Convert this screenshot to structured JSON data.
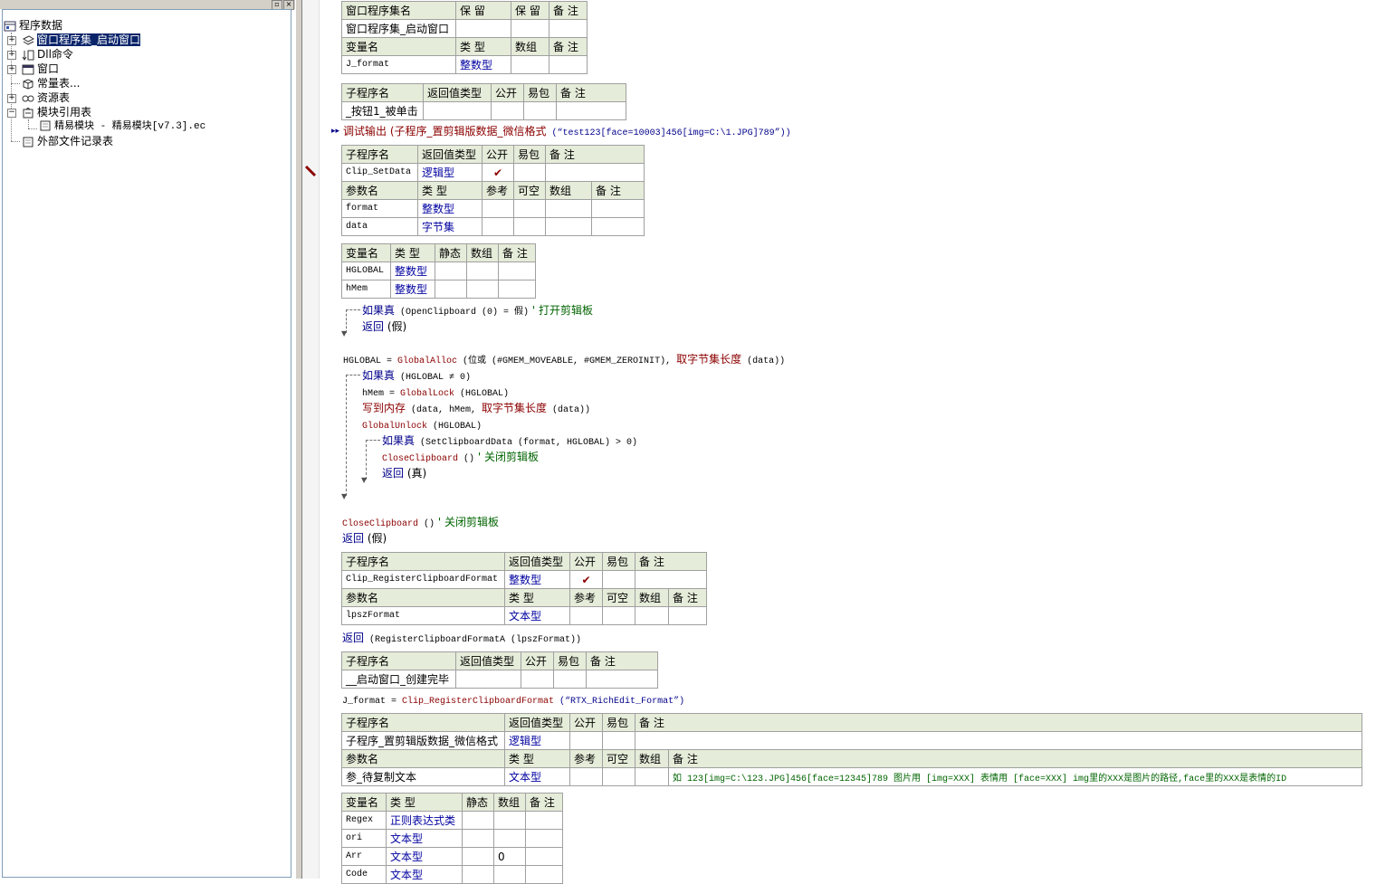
{
  "tree": {
    "root": "程序数据",
    "items": [
      {
        "label": "窗口程序集_启动窗口",
        "selected": true
      },
      {
        "label": "Dll命令"
      },
      {
        "label": "窗口"
      },
      {
        "label": "常量表..."
      },
      {
        "label": "资源表"
      },
      {
        "label": "模块引用表"
      },
      {
        "label": "精易模块 - 精易模块[v7.3].ec"
      },
      {
        "label": "外部文件记录表"
      }
    ]
  },
  "assembly_table": {
    "h1": [
      "窗口程序集名",
      "保 留",
      "保 留",
      "备 注"
    ],
    "r1": [
      "窗口程序集_启动窗口",
      "",
      "",
      ""
    ],
    "h2": [
      "变量名",
      "类 型",
      "数组",
      "备 注"
    ],
    "r2": [
      "J_format",
      "整数型",
      "",
      ""
    ]
  },
  "sub1": {
    "h": [
      "子程序名",
      "返回值类型",
      "公开",
      "易包",
      "备 注"
    ],
    "r": [
      "_按钮1_被单击",
      "",
      "",
      "",
      ""
    ]
  },
  "code1": {
    "kw": "调试输出",
    "open": "(",
    "fn": "子程序_置剪辑版数据_微信格式",
    "arg": " (“test123[face=10003]456[img=C:\\1.JPG]789”))"
  },
  "sub2": {
    "h": [
      "子程序名",
      "返回值类型",
      "公开",
      "易包",
      "备 注"
    ],
    "r": [
      "Clip_SetData",
      "逻辑型",
      "✔",
      "",
      ""
    ],
    "ph": [
      "参数名",
      "类 型",
      "参考",
      "可空",
      "数组",
      "备 注"
    ],
    "p": [
      [
        "format",
        "整数型",
        "",
        "",
        "",
        ""
      ],
      [
        "data",
        "字节集",
        "",
        "",
        "",
        ""
      ]
    ],
    "vh": [
      "变量名",
      "类 型",
      "静态",
      "数组",
      "备 注"
    ],
    "v": [
      [
        "HGLOBAL",
        "整数型",
        "",
        "",
        ""
      ],
      [
        "hMem",
        "整数型",
        "",
        "",
        ""
      ]
    ]
  },
  "code2": [
    {
      "a": "如果真",
      "b": " (OpenClipboard (0) = 假)",
      "c": " ' 打开剪辑板"
    },
    {
      "a": "返回",
      "b": " (假)",
      "c": ""
    },
    {
      "a": "HGLOBAL = ",
      "f": "GlobalAlloc",
      "b": " (位或 (#GMEM_MOVEABLE, #GMEM_ZEROINIT), ",
      "f2": "取字节集长度",
      "b2": " (data))"
    },
    {
      "a": "如果真",
      "b": " (HGLOBAL ≠ 0)",
      "c": ""
    },
    {
      "a": "hMem = ",
      "f": "GlobalLock",
      "b": " (HGLOBAL)"
    },
    {
      "a": "写到内存",
      "b": " (data, hMem, ",
      "f2": "取字节集长度",
      "b2": " (data))"
    },
    {
      "a": "GlobalUnlock",
      "b": " (HGLOBAL)"
    },
    {
      "a": "如果真",
      "b": " (SetClipboardData (format, HGLOBAL) > 0)"
    },
    {
      "a": "CloseClipboard",
      "b": " ()",
      "c": " ' 关闭剪辑板"
    },
    {
      "a": "返回",
      "b": " (真)"
    },
    {
      "a": "CloseClipboard",
      "b": " ()",
      "c": " ' 关闭剪辑板"
    },
    {
      "a": "返回",
      "b": " (假)"
    }
  ],
  "sub3": {
    "h": [
      "子程序名",
      "返回值类型",
      "公开",
      "易包",
      "备 注"
    ],
    "r": [
      "Clip_RegisterClipboardFormat",
      "整数型",
      "✔",
      "",
      ""
    ],
    "ph": [
      "参数名",
      "类 型",
      "参考",
      "可空",
      "数组",
      "备 注"
    ],
    "p": [
      [
        "lpszFormat",
        "文本型",
        "",
        "",
        "",
        ""
      ]
    ]
  },
  "code3": {
    "a": "返回",
    "b": " (RegisterClipboardFormatA (lpszFormat))"
  },
  "sub4": {
    "h": [
      "子程序名",
      "返回值类型",
      "公开",
      "易包",
      "备 注"
    ],
    "r": [
      "__启动窗口_创建完毕",
      "",
      "",
      "",
      ""
    ]
  },
  "code4": {
    "a": "J_format = ",
    "f": "Clip_RegisterClipboardFormat",
    "b": " (“RTX_RichEdit_Format”)"
  },
  "sub5": {
    "h": [
      "子程序名",
      "返回值类型",
      "公开",
      "易包",
      "备 注"
    ],
    "r": [
      "子程序_置剪辑版数据_微信格式",
      "逻辑型",
      "",
      "",
      ""
    ],
    "ph": [
      "参数名",
      "类 型",
      "参考",
      "可空",
      "数组",
      "备 注"
    ],
    "p": [
      [
        "参_待复制文本",
        "文本型",
        "",
        "",
        "",
        "如 123[img=C:\\123.JPG]456[face=12345]789    图片用 [img=XXX]  表情用 [face=XXX]   img里的XXX是图片的路径,face里的XXX是表情的ID"
      ]
    ],
    "vh": [
      "变量名",
      "类 型",
      "静态",
      "数组",
      "备 注"
    ],
    "v": [
      [
        "Regex",
        "正则表达式类",
        "",
        "",
        ""
      ],
      [
        "ori",
        "文本型",
        "",
        "",
        ""
      ],
      [
        "Arr",
        "文本型",
        "",
        "0",
        ""
      ],
      [
        "Code",
        "文本型",
        "",
        "",
        ""
      ]
    ]
  }
}
